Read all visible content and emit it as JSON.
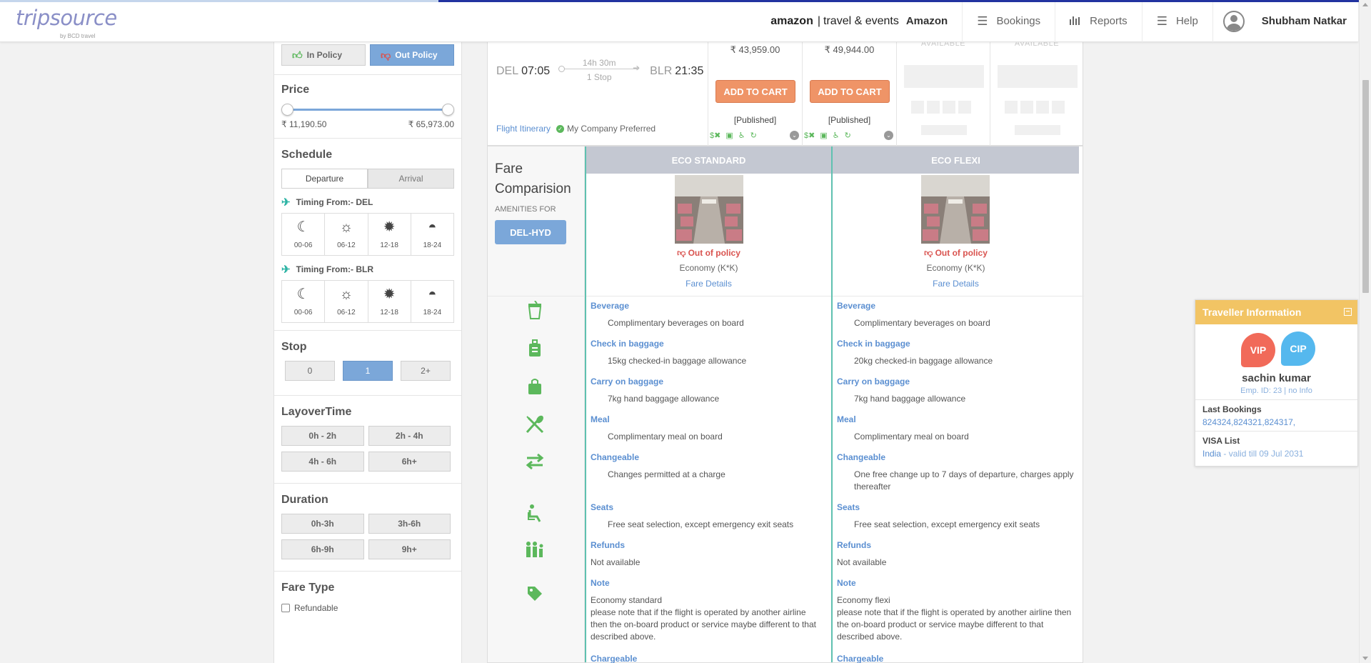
{
  "header": {
    "logo": "tripsource",
    "logo_sub": "by BCD travel",
    "amazon_logo": "amazon",
    "amazon_divider": "|",
    "amazon_tagline": "travel & events",
    "company": "Amazon",
    "nav": [
      {
        "label": "Bookings",
        "icon": "list-icon"
      },
      {
        "label": "Reports",
        "icon": "bar-chart-icon"
      },
      {
        "label": "Help",
        "icon": "list-icon"
      }
    ],
    "user": "Shubham Natkar"
  },
  "progress": {
    "fraction": 0.32
  },
  "filters": {
    "policy": {
      "in_label": "In Policy",
      "out_label": "Out Policy",
      "selected": "Out Policy"
    },
    "price": {
      "title": "Price",
      "min": "₹ 11,190.50",
      "max": "₹ 65,973.00",
      "low_fraction": 0.0,
      "high_fraction": 1.0
    },
    "schedule": {
      "title": "Schedule",
      "tabs": [
        "Departure",
        "Arrival"
      ],
      "active_tab": "Departure",
      "from_del_label": "Timing From:- DEL",
      "from_blr_label": "Timing From:- BLR",
      "slots": [
        "00-06",
        "06-12",
        "12-18",
        "18-24"
      ]
    },
    "stop": {
      "title": "Stop",
      "options": [
        "0",
        "1",
        "2+"
      ],
      "selected": "1"
    },
    "layover": {
      "title": "LayoverTime",
      "options": [
        "0h - 2h",
        "2h - 4h",
        "4h - 6h",
        "6h+"
      ]
    },
    "duration": {
      "title": "Duration",
      "options": [
        "0h-3h",
        "3h-6h",
        "6h-9h",
        "9h+"
      ]
    },
    "fare_type": {
      "title": "Fare Type",
      "refundable": "Refundable"
    }
  },
  "flight": {
    "from": "DEL",
    "depart": "07:05",
    "duration": "14h 30m",
    "stops": "1 Stop",
    "to": "BLR",
    "arrive": "21:35",
    "itinerary_link": "Flight Itinerary",
    "preferred": "My Company Preferred",
    "fares": [
      {
        "price": "₹ 43,959.00",
        "cart": "ADD TO CART",
        "type": "[Published]"
      },
      {
        "price": "₹ 49,944.00",
        "cart": "ADD TO CART",
        "type": "[Published]"
      }
    ],
    "unavailable": [
      "AVAILABLE",
      "AVAILABLE"
    ]
  },
  "comparison": {
    "title_line1": "Fare",
    "title_line2": "Comparision",
    "amenities_for": "AMENITIES FOR",
    "route": "DEL-HYD",
    "fares": [
      {
        "name": "ECO STANDARD",
        "policy": "Out of policy",
        "cabin": "Economy (K*K)",
        "details": "Fare Details",
        "items": [
          {
            "title": "Beverage",
            "desc": "Complimentary beverages on board"
          },
          {
            "title": "Check in baggage",
            "desc": "15kg checked-in baggage allowance"
          },
          {
            "title": "Carry on baggage",
            "desc": "7kg hand baggage allowance"
          },
          {
            "title": "Meal",
            "desc": "Complimentary meal on board"
          },
          {
            "title": "Changeable",
            "desc": "Changes permitted at a charge"
          },
          {
            "title": "Seats",
            "desc": "Free seat selection, except emergency exit seats"
          },
          {
            "title": "Refunds",
            "desc": "Not available"
          },
          {
            "title": "Note",
            "desc": "Economy standard\n please note that if the flight is operated by another airline then the on-board product or service maybe different to that described above."
          },
          {
            "title": "Chargeable",
            "desc": ""
          }
        ]
      },
      {
        "name": "ECO FLEXI",
        "policy": "Out of policy",
        "cabin": "Economy (K*K)",
        "details": "Fare Details",
        "items": [
          {
            "title": "Beverage",
            "desc": "Complimentary beverages on board"
          },
          {
            "title": "Check in baggage",
            "desc": "20kg checked-in baggage allowance"
          },
          {
            "title": "Carry on baggage",
            "desc": "7kg hand baggage allowance"
          },
          {
            "title": "Meal",
            "desc": "Complimentary meal on board"
          },
          {
            "title": "Changeable",
            "desc": "One free change up to 7 days of departure, charges apply thereafter"
          },
          {
            "title": "Seats",
            "desc": "Free seat selection, except emergency exit seats"
          },
          {
            "title": "Refunds",
            "desc": "Not available"
          },
          {
            "title": "Note",
            "desc": "Economy flexi\n please note that if the flight is operated by another airline then the on-board product or service maybe different to that described above."
          },
          {
            "title": "Chargeable",
            "desc": ""
          }
        ]
      }
    ],
    "row_icons": [
      "cup-icon",
      "luggage-icon",
      "bag-icon",
      "meal-icon",
      "swap-icon",
      "seat-icon",
      "family-icon",
      "tag-icon",
      "chargeable-icon"
    ]
  },
  "traveller": {
    "title": "Traveller Information",
    "badges": [
      "VIP",
      "CIP"
    ],
    "name": "sachin kumar",
    "emp_id": "Emp. ID: 23",
    "emp_sep": " | ",
    "emp_info": "no Info",
    "last_bookings_label": "Last Bookings",
    "last_bookings": "824324,824321,824317,",
    "visa_label": "VISA List",
    "visa_country": "India",
    "visa_valid": " - valid till 09 Jul 2031"
  },
  "colors": {
    "accent_blue": "#7ba7d9",
    "orange_cart": "#ef9467",
    "green": "#5cb85c",
    "teal": "#5fc1b0",
    "gold": "#f2c464"
  }
}
